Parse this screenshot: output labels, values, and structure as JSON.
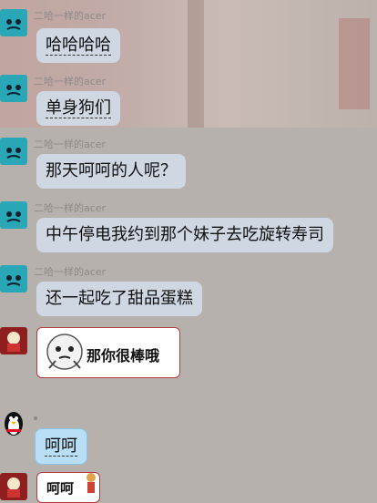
{
  "sender_name": "二哈一样的acer",
  "messages": [
    {
      "text": "哈哈哈哈"
    },
    {
      "text": "单身狗们"
    },
    {
      "text": "那天呵呵的人呢？"
    },
    {
      "text": "中午停电我约到那个妹子去吃旋转寿司"
    },
    {
      "text": "还一起吃了甜品蛋糕"
    }
  ],
  "sticker1_text": "那你很棒哦",
  "reply_text": "呵呵",
  "sticker2_text": "呵呵"
}
